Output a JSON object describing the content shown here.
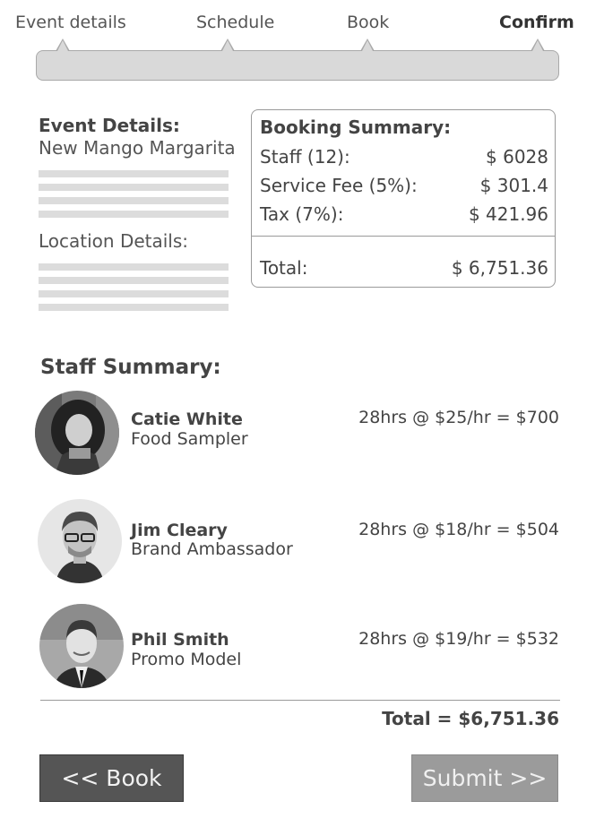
{
  "stepper": {
    "steps": [
      {
        "label": "Event details",
        "active": false
      },
      {
        "label": "Schedule",
        "active": false
      },
      {
        "label": "Book",
        "active": false
      },
      {
        "label": "Confirm",
        "active": true
      }
    ]
  },
  "event": {
    "heading": "Event Details:",
    "name": "New Mango Margarita",
    "location_heading": "Location Details:"
  },
  "booking_summary": {
    "title": "Booking Summary:",
    "rows": [
      {
        "label": "Staff (12):",
        "value": "$ 6028"
      },
      {
        "label": "Service Fee (5%):",
        "value": "$ 301.4"
      },
      {
        "label": "Tax (7%):",
        "value": "$ 421.96"
      }
    ],
    "total_label": "Total:",
    "total_value": "$ 6,751.36"
  },
  "staff_summary": {
    "heading": "Staff Summary:",
    "members": [
      {
        "name": "Catie White",
        "role": "Food Sampler",
        "rate": "28hrs @ $25/hr =  $700",
        "avatar_icon": "avatar-photo"
      },
      {
        "name": "Jim Cleary",
        "role": "Brand Ambassador",
        "rate": "28hrs @ $18/hr =  $504",
        "avatar_icon": "avatar-photo"
      },
      {
        "name": "Phil Smith",
        "role": "Promo Model",
        "rate": "28hrs @ $19/hr =  $532",
        "avatar_icon": "avatar-photo"
      }
    ],
    "total": "Total  =  $6,751.36"
  },
  "actions": {
    "back_label": "<< Book",
    "submit_label": "Submit  >>"
  },
  "colors": {
    "primary_button": "#555555",
    "disabled_button": "#9b9b9b",
    "progress_track": "#d9d9d9"
  }
}
